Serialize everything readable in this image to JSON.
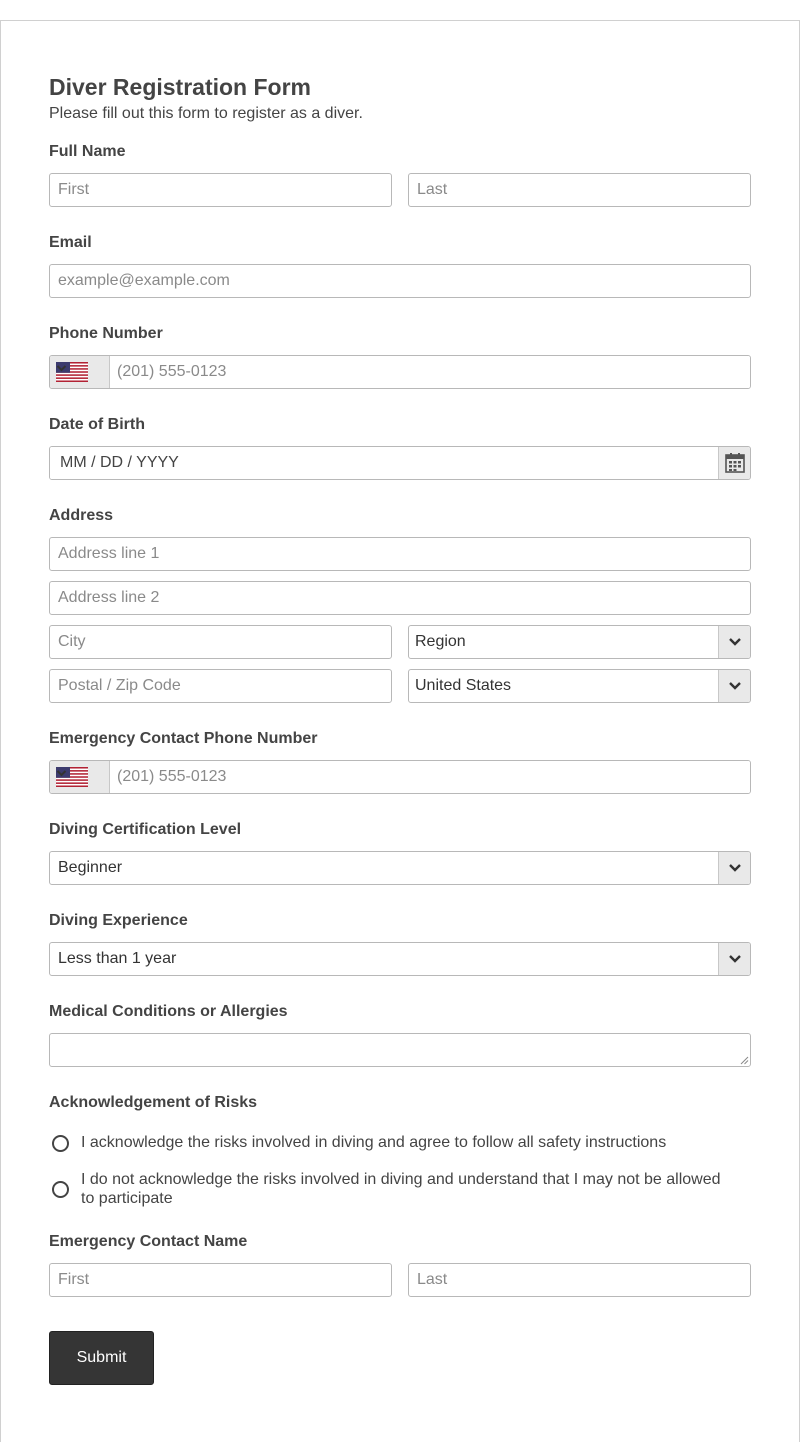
{
  "form": {
    "title": "Diver Registration Form",
    "subtitle": "Please fill out this form to register as a diver."
  },
  "full_name": {
    "label": "Full Name",
    "first_placeholder": "First",
    "last_placeholder": "Last"
  },
  "email": {
    "label": "Email",
    "placeholder": "example@example.com"
  },
  "phone": {
    "label": "Phone Number",
    "placeholder": "(201) 555-0123",
    "country_icon": "us-flag-icon"
  },
  "dob": {
    "label": "Date of Birth",
    "placeholder": "MM / DD / YYYY",
    "icon": "calendar-icon"
  },
  "address": {
    "label": "Address",
    "line1_placeholder": "Address line 1",
    "line2_placeholder": "Address line 2",
    "city_placeholder": "City",
    "region_value": "Region",
    "postal_placeholder": "Postal / Zip Code",
    "country_value": "United States"
  },
  "emergency_phone": {
    "label": "Emergency Contact Phone Number",
    "placeholder": "(201) 555-0123",
    "country_icon": "us-flag-icon"
  },
  "certification": {
    "label": "Diving Certification Level",
    "value": "Beginner"
  },
  "experience": {
    "label": "Diving Experience",
    "value": "Less than 1 year"
  },
  "medical": {
    "label": "Medical Conditions or Allergies"
  },
  "risks": {
    "label": "Acknowledgement of Risks",
    "options": [
      "I acknowledge the risks involved in diving and agree to follow all safety instructions",
      "I do not acknowledge the risks involved in diving and understand that I may not be allowed to participate"
    ]
  },
  "emergency_name": {
    "label": "Emergency Contact Name",
    "first_placeholder": "First",
    "last_placeholder": "Last"
  },
  "submit": {
    "label": "Submit"
  },
  "colors": {
    "button_bg": "#353535",
    "border": "#b8b8b8",
    "addon_bg": "#e9e9e9",
    "text": "#444444"
  }
}
